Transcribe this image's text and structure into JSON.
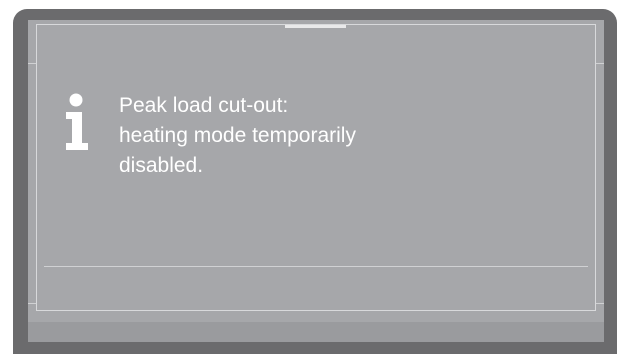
{
  "dialog": {
    "icon": "info-icon",
    "message_lines": [
      "Peak load cut-out:",
      "heating mode temporarily",
      "disabled."
    ]
  },
  "colors": {
    "frame": "#6b6b6d",
    "screen": "#a6a7aa",
    "text": "#ffffff",
    "lines": "#d8d9db"
  }
}
